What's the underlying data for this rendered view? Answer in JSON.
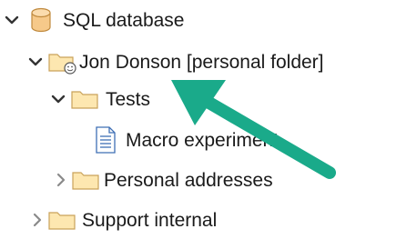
{
  "tree": {
    "items": [
      {
        "label": "SQL database",
        "icon": "database-icon",
        "expanded": true
      },
      {
        "label": "Jon Donson [personal folder]",
        "icon": "personal-folder-icon",
        "expanded": true
      },
      {
        "label": "Tests",
        "icon": "folder-icon",
        "expanded": true
      },
      {
        "label": "Macro experiment",
        "icon": "document-icon"
      },
      {
        "label": "Personal addresses",
        "icon": "folder-icon",
        "expanded": false
      },
      {
        "label": "Support internal",
        "icon": "folder-icon",
        "expanded": false
      }
    ]
  },
  "annotation": {
    "arrow_color": "#1aaa8a"
  },
  "colors": {
    "folder_fill": "#fde7b0",
    "folder_stroke": "#c9a25a",
    "db_fill": "#f6c98a",
    "chevron": "#333333"
  }
}
